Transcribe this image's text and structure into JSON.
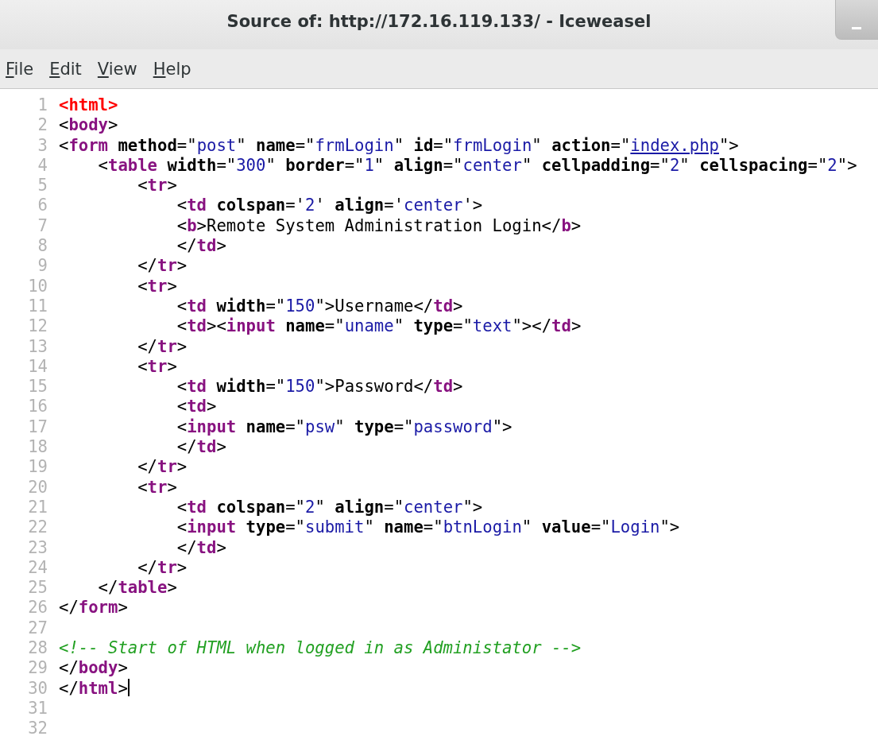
{
  "window": {
    "title": "Source of: http://172.16.119.133/ - Iceweasel"
  },
  "menu": [
    "File",
    "Edit",
    "View",
    "Help"
  ],
  "source": {
    "lines": [
      {
        "number": "1",
        "cursor": false,
        "tokens": [
          {
            "kind": "root_tag",
            "text": "<html>"
          }
        ]
      },
      {
        "number": "2",
        "cursor": false,
        "tokens": [
          {
            "kind": "punct",
            "text": "<"
          },
          {
            "kind": "tag",
            "text": "body"
          },
          {
            "kind": "punct",
            "text": ">"
          }
        ]
      },
      {
        "number": "3",
        "cursor": false,
        "tokens": [
          {
            "kind": "punct",
            "text": "<"
          },
          {
            "kind": "tag",
            "text": "form"
          },
          {
            "kind": "attr",
            "text": " method"
          },
          {
            "kind": "punct",
            "text": "=\""
          },
          {
            "kind": "value",
            "text": "post"
          },
          {
            "kind": "punct",
            "text": "\" "
          },
          {
            "kind": "attr",
            "text": "name"
          },
          {
            "kind": "punct",
            "text": "=\""
          },
          {
            "kind": "value",
            "text": "frmLogin"
          },
          {
            "kind": "punct",
            "text": "\" "
          },
          {
            "kind": "attr",
            "text": "id"
          },
          {
            "kind": "punct",
            "text": "=\""
          },
          {
            "kind": "value",
            "text": "frmLogin"
          },
          {
            "kind": "punct",
            "text": "\" "
          },
          {
            "kind": "attr",
            "text": "action"
          },
          {
            "kind": "punct",
            "text": "=\""
          },
          {
            "kind": "link",
            "text": "index.php"
          },
          {
            "kind": "punct",
            "text": "\">"
          }
        ]
      },
      {
        "number": "4",
        "cursor": false,
        "tokens": [
          {
            "kind": "punct",
            "text": "    <"
          },
          {
            "kind": "tag",
            "text": "table"
          },
          {
            "kind": "attr",
            "text": " width"
          },
          {
            "kind": "punct",
            "text": "=\""
          },
          {
            "kind": "value",
            "text": "300"
          },
          {
            "kind": "punct",
            "text": "\" "
          },
          {
            "kind": "attr",
            "text": "border"
          },
          {
            "kind": "punct",
            "text": "=\""
          },
          {
            "kind": "value",
            "text": "1"
          },
          {
            "kind": "punct",
            "text": "\" "
          },
          {
            "kind": "attr",
            "text": "align"
          },
          {
            "kind": "punct",
            "text": "=\""
          },
          {
            "kind": "value",
            "text": "center"
          },
          {
            "kind": "punct",
            "text": "\" "
          },
          {
            "kind": "attr",
            "text": "cellpadding"
          },
          {
            "kind": "punct",
            "text": "=\""
          },
          {
            "kind": "value",
            "text": "2"
          },
          {
            "kind": "punct",
            "text": "\" "
          },
          {
            "kind": "attr",
            "text": "cellspacing"
          },
          {
            "kind": "punct",
            "text": "=\""
          },
          {
            "kind": "value",
            "text": "2"
          },
          {
            "kind": "punct",
            "text": "\">"
          }
        ]
      },
      {
        "number": "5",
        "cursor": false,
        "tokens": [
          {
            "kind": "punct",
            "text": "        <"
          },
          {
            "kind": "tag",
            "text": "tr"
          },
          {
            "kind": "punct",
            "text": ">"
          }
        ]
      },
      {
        "number": "6",
        "cursor": false,
        "tokens": [
          {
            "kind": "punct",
            "text": "            <"
          },
          {
            "kind": "tag",
            "text": "td"
          },
          {
            "kind": "attr",
            "text": " colspan"
          },
          {
            "kind": "punct",
            "text": "='"
          },
          {
            "kind": "value",
            "text": "2"
          },
          {
            "kind": "punct",
            "text": "' "
          },
          {
            "kind": "attr",
            "text": "align"
          },
          {
            "kind": "punct",
            "text": "='"
          },
          {
            "kind": "value",
            "text": "center"
          },
          {
            "kind": "punct",
            "text": "'>"
          }
        ]
      },
      {
        "number": "7",
        "cursor": false,
        "tokens": [
          {
            "kind": "punct",
            "text": "            <"
          },
          {
            "kind": "tag",
            "text": "b"
          },
          {
            "kind": "punct",
            "text": ">"
          },
          {
            "kind": "text",
            "text": "Remote System Administration Login"
          },
          {
            "kind": "punct",
            "text": "</"
          },
          {
            "kind": "tag",
            "text": "b"
          },
          {
            "kind": "punct",
            "text": ">"
          }
        ]
      },
      {
        "number": "8",
        "cursor": false,
        "tokens": [
          {
            "kind": "punct",
            "text": "            </"
          },
          {
            "kind": "tag",
            "text": "td"
          },
          {
            "kind": "punct",
            "text": ">"
          }
        ]
      },
      {
        "number": "9",
        "cursor": false,
        "tokens": [
          {
            "kind": "punct",
            "text": "        </"
          },
          {
            "kind": "tag",
            "text": "tr"
          },
          {
            "kind": "punct",
            "text": ">"
          }
        ]
      },
      {
        "number": "10",
        "cursor": false,
        "tokens": [
          {
            "kind": "punct",
            "text": "        <"
          },
          {
            "kind": "tag",
            "text": "tr"
          },
          {
            "kind": "punct",
            "text": ">"
          }
        ]
      },
      {
        "number": "11",
        "cursor": false,
        "tokens": [
          {
            "kind": "punct",
            "text": "            <"
          },
          {
            "kind": "tag",
            "text": "td"
          },
          {
            "kind": "attr",
            "text": " width"
          },
          {
            "kind": "punct",
            "text": "=\""
          },
          {
            "kind": "value",
            "text": "150"
          },
          {
            "kind": "punct",
            "text": "\">"
          },
          {
            "kind": "text",
            "text": "Username"
          },
          {
            "kind": "punct",
            "text": "</"
          },
          {
            "kind": "tag",
            "text": "td"
          },
          {
            "kind": "punct",
            "text": ">"
          }
        ]
      },
      {
        "number": "12",
        "cursor": false,
        "tokens": [
          {
            "kind": "punct",
            "text": "            <"
          },
          {
            "kind": "tag",
            "text": "td"
          },
          {
            "kind": "punct",
            "text": "><"
          },
          {
            "kind": "tag",
            "text": "input"
          },
          {
            "kind": "attr",
            "text": " name"
          },
          {
            "kind": "punct",
            "text": "=\""
          },
          {
            "kind": "value",
            "text": "uname"
          },
          {
            "kind": "punct",
            "text": "\" "
          },
          {
            "kind": "attr",
            "text": "type"
          },
          {
            "kind": "punct",
            "text": "=\""
          },
          {
            "kind": "value",
            "text": "text"
          },
          {
            "kind": "punct",
            "text": "\"></"
          },
          {
            "kind": "tag",
            "text": "td"
          },
          {
            "kind": "punct",
            "text": ">"
          }
        ]
      },
      {
        "number": "13",
        "cursor": false,
        "tokens": [
          {
            "kind": "punct",
            "text": "        </"
          },
          {
            "kind": "tag",
            "text": "tr"
          },
          {
            "kind": "punct",
            "text": ">"
          }
        ]
      },
      {
        "number": "14",
        "cursor": false,
        "tokens": [
          {
            "kind": "punct",
            "text": "        <"
          },
          {
            "kind": "tag",
            "text": "tr"
          },
          {
            "kind": "punct",
            "text": ">"
          }
        ]
      },
      {
        "number": "15",
        "cursor": false,
        "tokens": [
          {
            "kind": "punct",
            "text": "            <"
          },
          {
            "kind": "tag",
            "text": "td"
          },
          {
            "kind": "attr",
            "text": " width"
          },
          {
            "kind": "punct",
            "text": "=\""
          },
          {
            "kind": "value",
            "text": "150"
          },
          {
            "kind": "punct",
            "text": "\">"
          },
          {
            "kind": "text",
            "text": "Password"
          },
          {
            "kind": "punct",
            "text": "</"
          },
          {
            "kind": "tag",
            "text": "td"
          },
          {
            "kind": "punct",
            "text": ">"
          }
        ]
      },
      {
        "number": "16",
        "cursor": false,
        "tokens": [
          {
            "kind": "punct",
            "text": "            <"
          },
          {
            "kind": "tag",
            "text": "td"
          },
          {
            "kind": "punct",
            "text": ">"
          }
        ]
      },
      {
        "number": "17",
        "cursor": false,
        "tokens": [
          {
            "kind": "punct",
            "text": "            <"
          },
          {
            "kind": "tag",
            "text": "input"
          },
          {
            "kind": "attr",
            "text": " name"
          },
          {
            "kind": "punct",
            "text": "=\""
          },
          {
            "kind": "value",
            "text": "psw"
          },
          {
            "kind": "punct",
            "text": "\" "
          },
          {
            "kind": "attr",
            "text": "type"
          },
          {
            "kind": "punct",
            "text": "=\""
          },
          {
            "kind": "value",
            "text": "password"
          },
          {
            "kind": "punct",
            "text": "\">"
          }
        ]
      },
      {
        "number": "18",
        "cursor": false,
        "tokens": [
          {
            "kind": "punct",
            "text": "            </"
          },
          {
            "kind": "tag",
            "text": "td"
          },
          {
            "kind": "punct",
            "text": ">"
          }
        ]
      },
      {
        "number": "19",
        "cursor": false,
        "tokens": [
          {
            "kind": "punct",
            "text": "        </"
          },
          {
            "kind": "tag",
            "text": "tr"
          },
          {
            "kind": "punct",
            "text": ">"
          }
        ]
      },
      {
        "number": "20",
        "cursor": false,
        "tokens": [
          {
            "kind": "punct",
            "text": "        <"
          },
          {
            "kind": "tag",
            "text": "tr"
          },
          {
            "kind": "punct",
            "text": ">"
          }
        ]
      },
      {
        "number": "21",
        "cursor": false,
        "tokens": [
          {
            "kind": "punct",
            "text": "            <"
          },
          {
            "kind": "tag",
            "text": "td"
          },
          {
            "kind": "attr",
            "text": " colspan"
          },
          {
            "kind": "punct",
            "text": "=\""
          },
          {
            "kind": "value",
            "text": "2"
          },
          {
            "kind": "punct",
            "text": "\" "
          },
          {
            "kind": "attr",
            "text": "align"
          },
          {
            "kind": "punct",
            "text": "=\""
          },
          {
            "kind": "value",
            "text": "center"
          },
          {
            "kind": "punct",
            "text": "\">"
          }
        ]
      },
      {
        "number": "22",
        "cursor": false,
        "tokens": [
          {
            "kind": "punct",
            "text": "            <"
          },
          {
            "kind": "tag",
            "text": "input"
          },
          {
            "kind": "attr",
            "text": " type"
          },
          {
            "kind": "punct",
            "text": "=\""
          },
          {
            "kind": "value",
            "text": "submit"
          },
          {
            "kind": "punct",
            "text": "\" "
          },
          {
            "kind": "attr",
            "text": "name"
          },
          {
            "kind": "punct",
            "text": "=\""
          },
          {
            "kind": "value",
            "text": "btnLogin"
          },
          {
            "kind": "punct",
            "text": "\" "
          },
          {
            "kind": "attr",
            "text": "value"
          },
          {
            "kind": "punct",
            "text": "=\""
          },
          {
            "kind": "value",
            "text": "Login"
          },
          {
            "kind": "punct",
            "text": "\">"
          }
        ]
      },
      {
        "number": "23",
        "cursor": false,
        "tokens": [
          {
            "kind": "punct",
            "text": "            </"
          },
          {
            "kind": "tag",
            "text": "td"
          },
          {
            "kind": "punct",
            "text": ">"
          }
        ]
      },
      {
        "number": "24",
        "cursor": false,
        "tokens": [
          {
            "kind": "punct",
            "text": "        </"
          },
          {
            "kind": "tag",
            "text": "tr"
          },
          {
            "kind": "punct",
            "text": ">"
          }
        ]
      },
      {
        "number": "25",
        "cursor": false,
        "tokens": [
          {
            "kind": "punct",
            "text": "    </"
          },
          {
            "kind": "tag",
            "text": "table"
          },
          {
            "kind": "punct",
            "text": ">"
          }
        ]
      },
      {
        "number": "26",
        "cursor": false,
        "tokens": [
          {
            "kind": "punct",
            "text": "</"
          },
          {
            "kind": "tag",
            "text": "form"
          },
          {
            "kind": "punct",
            "text": ">"
          }
        ]
      },
      {
        "number": "27",
        "cursor": false
      },
      {
        "number": "28",
        "cursor": false,
        "tokens": [
          {
            "kind": "comment",
            "text": "<!-- Start of HTML when logged in as Administator -->"
          }
        ]
      },
      {
        "number": "29",
        "cursor": false,
        "tokens": [
          {
            "kind": "punct",
            "text": "</"
          },
          {
            "kind": "tag",
            "text": "body"
          },
          {
            "kind": "punct",
            "text": ">"
          }
        ]
      },
      {
        "number": "30",
        "cursor": true,
        "tokens": [
          {
            "kind": "punct",
            "text": "</"
          },
          {
            "kind": "tag",
            "text": "html"
          },
          {
            "kind": "punct",
            "text": ">"
          }
        ]
      },
      {
        "number": "31",
        "cursor": false
      },
      {
        "number": "32",
        "cursor": false
      }
    ]
  }
}
